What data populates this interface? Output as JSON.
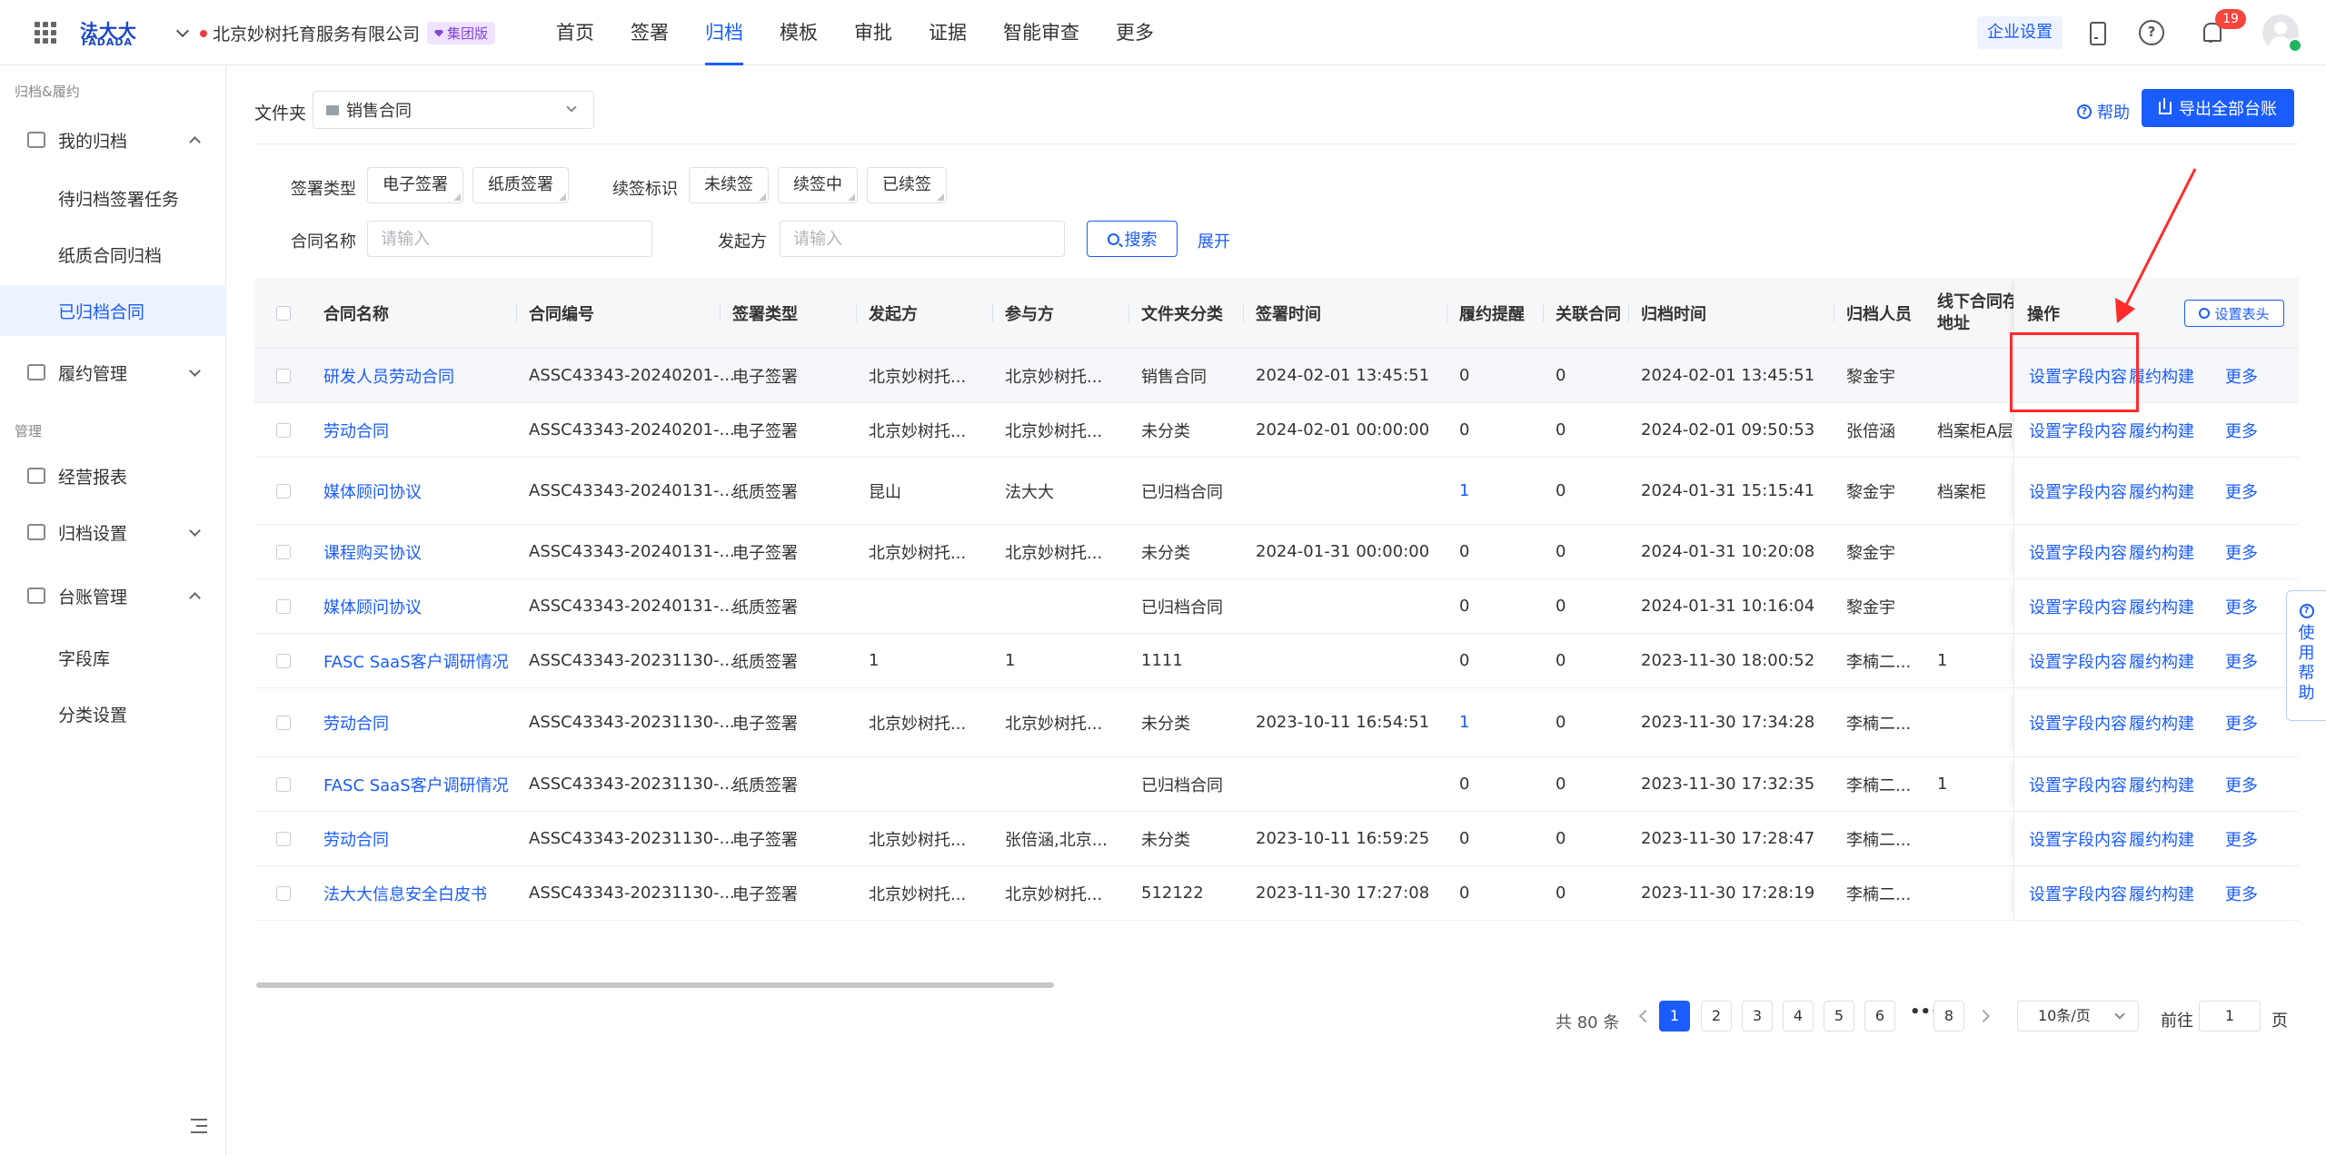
{
  "header": {
    "logo_cn": "法大大",
    "logo_en": "FADADA",
    "company": "北京妙树托育服务有限公司",
    "edition_badge": "集团版",
    "nav": [
      "首页",
      "签署",
      "归档",
      "模板",
      "审批",
      "证据",
      "智能审查",
      "更多"
    ],
    "active_nav": "归档",
    "enterprise_settings": "企业设置",
    "notification_count": "19"
  },
  "sidebar": {
    "group1": "归档&履约",
    "my_archive": "我的归档",
    "pending_tasks": "待归档签署任务",
    "paper_archive": "纸质合同归档",
    "archived_contracts": "已归档合同",
    "fulfillment": "履约管理",
    "group2": "管理",
    "reports": "经营报表",
    "archive_settings": "归档设置",
    "ledger": "台账管理",
    "field_library": "字段库",
    "category_settings": "分类设置"
  },
  "toolbar": {
    "folder_label": "文件夹",
    "folder_value": "销售合同",
    "help": "帮助",
    "export": "导出全部台账"
  },
  "filters": {
    "sign_type_label": "签署类型",
    "sign_types": [
      "电子签署",
      "纸质签署"
    ],
    "renewal_label": "续签标识",
    "renewals": [
      "未续签",
      "续签中",
      "已续签"
    ],
    "contract_name_label": "合同名称",
    "contract_name_placeholder": "请输入",
    "initiator_label": "发起方",
    "initiator_placeholder": "请输入",
    "search": "搜索",
    "expand": "展开"
  },
  "table": {
    "headers": {
      "name": "合同名称",
      "code": "合同编号",
      "sign_type": "签署类型",
      "initiator": "发起方",
      "participant": "参与方",
      "folder_category": "文件夹分类",
      "sign_time": "签署时间",
      "reminder": "履约提醒",
      "related": "关联合同",
      "archive_time": "归档时间",
      "archiver": "归档人员",
      "offline_line1": "线下合同存",
      "offline_line2": "地址",
      "ops": "操作",
      "set_header": "设置表头"
    },
    "ops": {
      "set_fields": "设置字段内容",
      "build": "履约构建",
      "more": "更多"
    },
    "rows": [
      {
        "name": "研发人员劳动合同",
        "code": "ASSC43343-20240201-...",
        "sign_type": "电子签署",
        "initiator": "北京妙树托...",
        "participant": "北京妙树托...",
        "folder": "销售合同",
        "sign_time": "2024-02-01 13:45:51",
        "reminder": "0",
        "related": "0",
        "archive_time": "2024-02-01 13:45:51",
        "archiver": "黎金宇",
        "offline": ""
      },
      {
        "name": "劳动合同",
        "code": "ASSC43343-20240201-...",
        "sign_type": "电子签署",
        "initiator": "北京妙树托...",
        "participant": "北京妙树托...",
        "folder": "未分类",
        "sign_time": "2024-02-01 00:00:00",
        "reminder": "0",
        "related": "0",
        "archive_time": "2024-02-01 09:50:53",
        "archiver": "张倍涵",
        "offline": "档案柜A层"
      },
      {
        "name": "媒体顾问协议",
        "code": "ASSC43343-20240131-...",
        "sign_type": "纸质签署",
        "initiator": "昆山",
        "participant": "法大大",
        "folder": "已归档合同",
        "sign_time": "",
        "reminder": "1",
        "related": "0",
        "archive_time": "2024-01-31 15:15:41",
        "archiver": "黎金宇",
        "offline": "档案柜"
      },
      {
        "name": "课程购买协议",
        "code": "ASSC43343-20240131-...",
        "sign_type": "电子签署",
        "initiator": "北京妙树托...",
        "participant": "北京妙树托...",
        "folder": "未分类",
        "sign_time": "2024-01-31 00:00:00",
        "reminder": "0",
        "related": "0",
        "archive_time": "2024-01-31 10:20:08",
        "archiver": "黎金宇",
        "offline": ""
      },
      {
        "name": "媒体顾问协议",
        "code": "ASSC43343-20240131-...",
        "sign_type": "纸质签署",
        "initiator": "",
        "participant": "",
        "folder": "已归档合同",
        "sign_time": "",
        "reminder": "0",
        "related": "0",
        "archive_time": "2024-01-31 10:16:04",
        "archiver": "黎金宇",
        "offline": ""
      },
      {
        "name": "FASC SaaS客户调研情况",
        "code": "ASSC43343-20231130-...",
        "sign_type": "纸质签署",
        "initiator": "1",
        "participant": "1",
        "folder": "1111",
        "sign_time": "",
        "reminder": "0",
        "related": "0",
        "archive_time": "2023-11-30 18:00:52",
        "archiver": "李楠二...",
        "offline": "1"
      },
      {
        "name": "劳动合同",
        "code": "ASSC43343-20231130-...",
        "sign_type": "电子签署",
        "initiator": "北京妙树托...",
        "participant": "北京妙树托...",
        "folder": "未分类",
        "sign_time": "2023-10-11 16:54:51",
        "reminder": "1",
        "related": "0",
        "archive_time": "2023-11-30 17:34:28",
        "archiver": "李楠二...",
        "offline": ""
      },
      {
        "name": "FASC SaaS客户调研情况",
        "code": "ASSC43343-20231130-...",
        "sign_type": "纸质签署",
        "initiator": "",
        "participant": "",
        "folder": "已归档合同",
        "sign_time": "",
        "reminder": "0",
        "related": "0",
        "archive_time": "2023-11-30 17:32:35",
        "archiver": "李楠二...",
        "offline": "1"
      },
      {
        "name": "劳动合同",
        "code": "ASSC43343-20231130-...",
        "sign_type": "电子签署",
        "initiator": "北京妙树托...",
        "participant": "张倍涵,北京...",
        "folder": "未分类",
        "sign_time": "2023-10-11 16:59:25",
        "reminder": "0",
        "related": "0",
        "archive_time": "2023-11-30 17:28:47",
        "archiver": "李楠二...",
        "offline": ""
      },
      {
        "name": "法大大信息安全白皮书",
        "code": "ASSC43343-20231130-...",
        "sign_type": "电子签署",
        "initiator": "北京妙树托...",
        "participant": "北京妙树托...",
        "folder": "512122",
        "sign_time": "2023-11-30 17:27:08",
        "reminder": "0",
        "related": "0",
        "archive_time": "2023-11-30 17:28:19",
        "archiver": "李楠二...",
        "offline": ""
      }
    ]
  },
  "pagination": {
    "total": "共 80 条",
    "pages": [
      "1",
      "2",
      "3",
      "4",
      "5",
      "6"
    ],
    "ellipsis": "•••",
    "last_page": "8",
    "active_page": "1",
    "page_size": "10条/页",
    "goto_label": "前往",
    "goto_value": "1",
    "page_suffix": "页"
  },
  "help_tab": {
    "chars": [
      "使",
      "用",
      "帮",
      "助"
    ]
  },
  "colors": {
    "primary": "#1a5cff",
    "annotation": "#ff2b2b"
  }
}
